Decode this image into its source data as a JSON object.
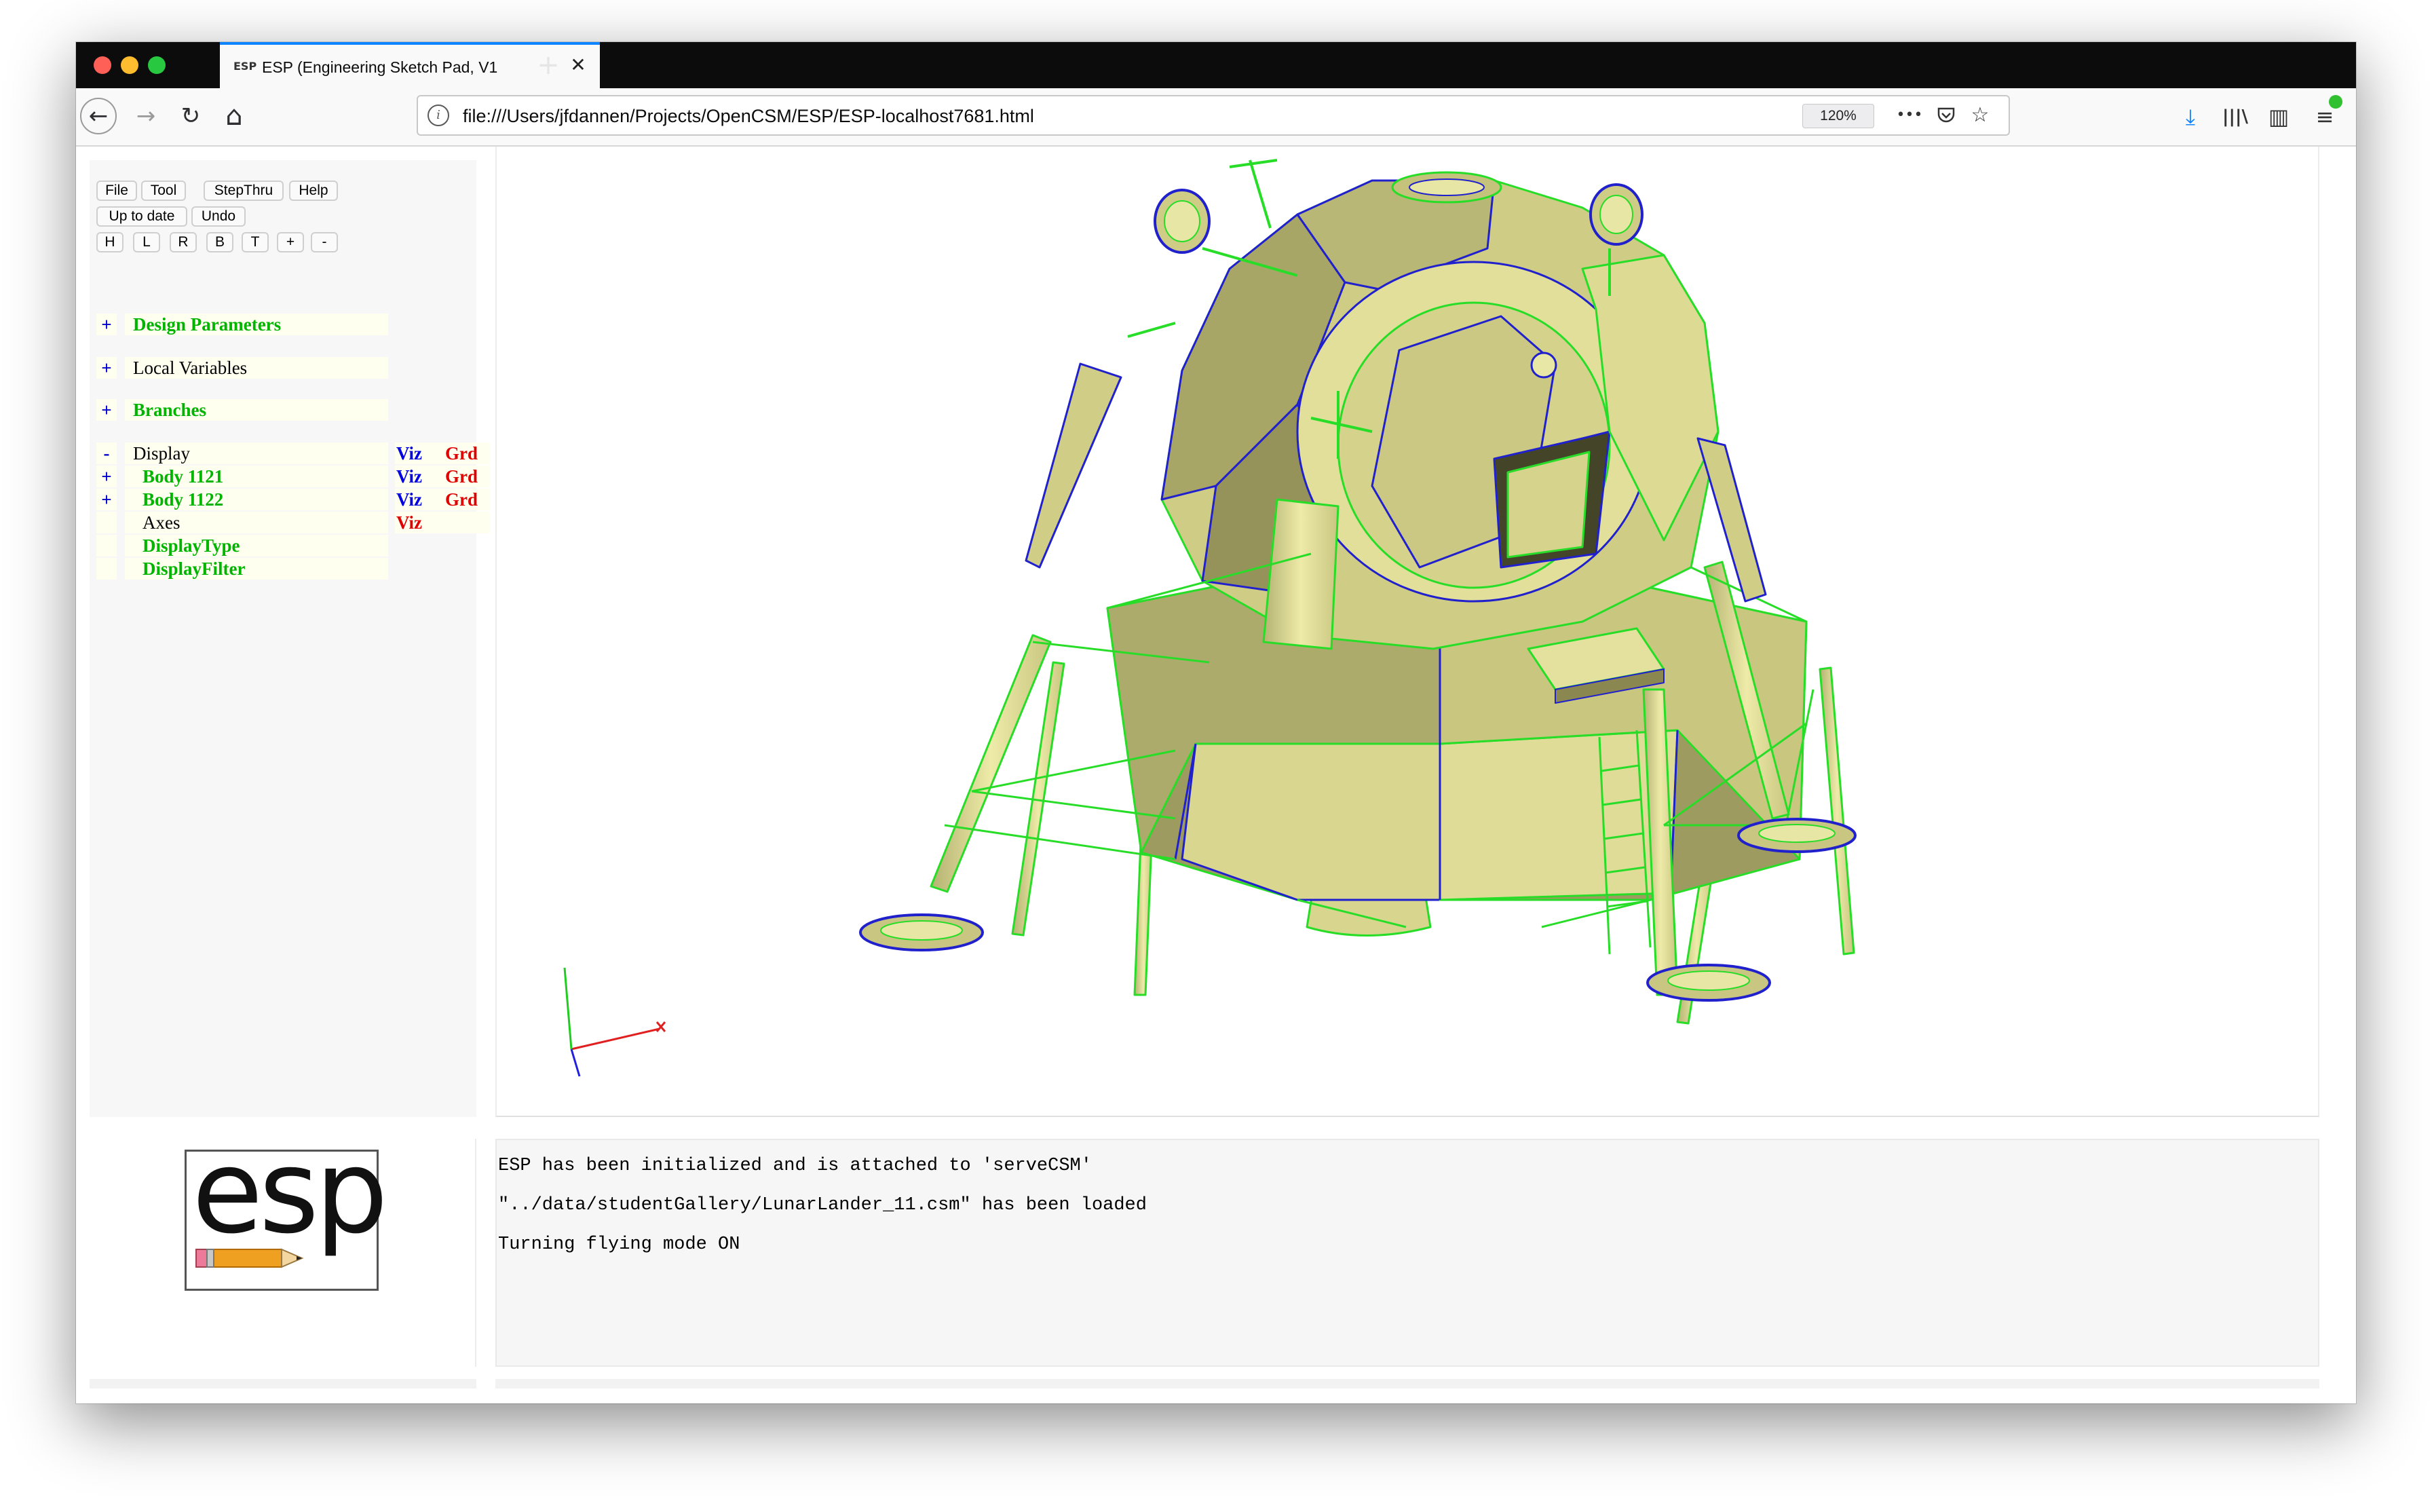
{
  "browser": {
    "tab": {
      "favicon": "ESP",
      "title": "ESP (Engineering Sketch Pad, V1",
      "close": "✕"
    },
    "new_tab": "+",
    "url": "file:///Users/jfdannen/Projects/OpenCSM/ESP/ESP-localhost7681.html",
    "zoom": "120%",
    "icons": {
      "back": "back-arrow-icon",
      "forward": "forward-arrow-icon",
      "reload": "reload-icon",
      "home": "home-icon",
      "info": "info-icon",
      "more": "more-dots-icon",
      "pocket": "pocket-icon",
      "bookmark": "star-icon",
      "download": "download-icon",
      "library": "library-icon",
      "sidebar": "sidebar-icon",
      "menu": "hamburger-menu-icon"
    },
    "glyphs": {
      "back": "←",
      "forward": "→",
      "reload": "↻",
      "home": "⌂",
      "info": "i",
      "more": "•••",
      "pocket": "◡",
      "bookmark": "☆",
      "download": "⤓",
      "library": "|||\\",
      "sidebar": "▥",
      "menu": "≡"
    }
  },
  "toolbar": {
    "row1": [
      "File",
      "Tool",
      "StepThru",
      "Help"
    ],
    "row2": [
      "Up to date",
      "Undo"
    ],
    "row3": [
      "H",
      "L",
      "R",
      "B",
      "T",
      "+",
      "-"
    ]
  },
  "tree": {
    "design_parameters": {
      "sym": "+",
      "label": "Design Parameters"
    },
    "local_variables": {
      "sym": "+",
      "label": "Local Variables"
    },
    "branches": {
      "sym": "+",
      "label": "Branches"
    },
    "display": {
      "sym": "-",
      "label": "Display",
      "viz": "Viz",
      "grd": "Grd"
    },
    "body1121": {
      "sym": "+",
      "label": "Body 1121",
      "viz": "Viz",
      "grd": "Grd"
    },
    "body1122": {
      "sym": "+",
      "label": "Body 1122",
      "viz": "Viz",
      "grd": "Grd"
    },
    "axes": {
      "label": "Axes",
      "viz": "Viz"
    },
    "display_type": {
      "label": "DisplayType"
    },
    "display_filter": {
      "label": "DisplayFilter"
    }
  },
  "logo": {
    "text": "esp"
  },
  "messages": [
    "ESP has been initialized and is attached to 'serveCSM'",
    "\"../data/studentGallery/LunarLander_11.csm\" has been loaded",
    "Turning flying mode ON"
  ],
  "colors": {
    "model_fill": "#d9d98c",
    "model_shade": "#a3a163",
    "edge_green": "#22e022",
    "edge_blue": "#1a1acc",
    "accent_blue": "#0a84ff"
  }
}
